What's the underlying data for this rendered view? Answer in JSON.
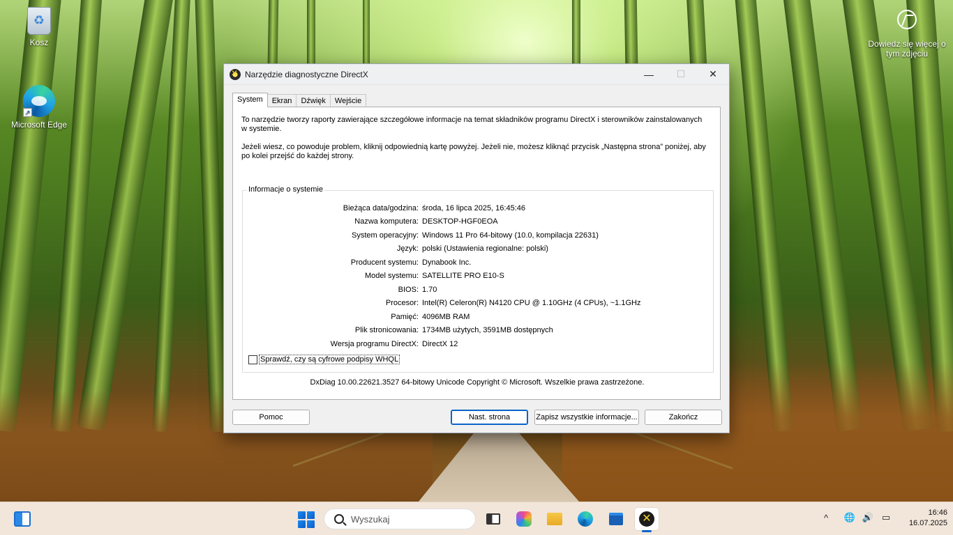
{
  "desktop": {
    "icons": [
      {
        "label": "Kosz"
      },
      {
        "label": "Microsoft Edge"
      }
    ],
    "learn_more": "Dowiedz się więcej o tym zdjęciu"
  },
  "window": {
    "title": "Narzędzie diagnostyczne DirectX",
    "controls": {
      "minimize": "—",
      "maximize": "☐",
      "close": "✕"
    },
    "tabs": [
      {
        "label": "System",
        "active": true
      },
      {
        "label": "Ekran"
      },
      {
        "label": "Dźwięk"
      },
      {
        "label": "Wejście"
      }
    ],
    "intro": [
      "To narzędzie tworzy raporty zawierające szczegółowe informacje na temat składników programu DirectX i sterowników zainstalowanych w systemie.",
      "Jeżeli wiesz, co powoduje problem, kliknij odpowiednią kartę powyżej. Jeżeli nie, możesz kliknąć przycisk „Następna strona” poniżej, aby po kolei przejść do każdej strony."
    ],
    "group_title": "Informacje o systemie",
    "rows": [
      {
        "label": "Bieżąca data/godzina:",
        "value": "środa, 16 lipca 2025, 16:45:46"
      },
      {
        "label": "Nazwa komputera:",
        "value": "DESKTOP-HGF0EOA"
      },
      {
        "label": "System operacyjny:",
        "value": "Windows 11 Pro 64-bitowy (10.0, kompilacja 22631)"
      },
      {
        "label": "Język:",
        "value": "polski (Ustawienia regionalne: polski)"
      },
      {
        "label": "Producent systemu:",
        "value": "Dynabook Inc."
      },
      {
        "label": "Model systemu:",
        "value": "SATELLITE PRO E10-S"
      },
      {
        "label": "BIOS:",
        "value": "1.70"
      },
      {
        "label": "Procesor:",
        "value": "Intel(R) Celeron(R) N4120 CPU @ 1.10GHz (4 CPUs), ~1.1GHz"
      },
      {
        "label": "Pamięć:",
        "value": "4096MB RAM"
      },
      {
        "label": "Plik stronicowania:",
        "value": "1734MB użytych, 3591MB dostępnych"
      },
      {
        "label": "Wersja programu DirectX:",
        "value": "DirectX 12"
      }
    ],
    "whql_label": "Sprawdź, czy są cyfrowe podpisy WHQL",
    "whql_checked": false,
    "copyright": "DxDiag 10.00.22621.3527 64-bitowy Unicode  Copyright © Microsoft. Wszelkie prawa zastrzeżone.",
    "buttons": {
      "help": "Pomoc",
      "next": "Nast. strona",
      "save": "Zapisz wszystkie informacje...",
      "exit": "Zakończ"
    }
  },
  "taskbar": {
    "search_placeholder": "Wyszukaj",
    "apps": [
      "task-view",
      "copilot",
      "file-explorer",
      "edge",
      "store",
      "directx-diagnostic"
    ],
    "tray": {
      "chevron": "^",
      "network": "🌐",
      "volume": "🔊",
      "battery": "▭"
    },
    "time": "16:46",
    "date": "16.07.2025"
  }
}
